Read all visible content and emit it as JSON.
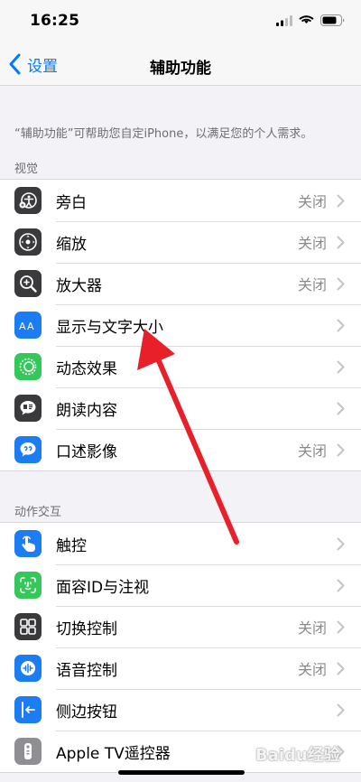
{
  "status_bar": {
    "time": "16:25"
  },
  "nav": {
    "back_label": "设置",
    "title": "辅助功能"
  },
  "description": "“辅助功能”可帮助您自定iPhone，以满足您的个人需求。",
  "sections": [
    {
      "header": "视觉",
      "items": [
        {
          "label": "旁白",
          "value": "关闭",
          "icon": "voiceover-icon",
          "color": "#3a3a3c"
        },
        {
          "label": "缩放",
          "value": "关闭",
          "icon": "zoom-icon",
          "color": "#3a3a3c"
        },
        {
          "label": "放大器",
          "value": "关闭",
          "icon": "magnifier-icon",
          "color": "#3a3a3c"
        },
        {
          "label": "显示与文字大小",
          "value": "",
          "icon": "text-size-icon",
          "color": "#1c7cf4"
        },
        {
          "label": "动态效果",
          "value": "",
          "icon": "motion-icon",
          "color": "#34c759"
        },
        {
          "label": "朗读内容",
          "value": "",
          "icon": "spoken-content-icon",
          "color": "#3a3a3c"
        },
        {
          "label": "口述影像",
          "value": "关闭",
          "icon": "audio-description-icon",
          "color": "#1c7cf4"
        }
      ]
    },
    {
      "header": "动作交互",
      "items": [
        {
          "label": "触控",
          "value": "",
          "icon": "touch-icon",
          "color": "#1c7cf4"
        },
        {
          "label": "面容ID与注视",
          "value": "",
          "icon": "face-id-icon",
          "color": "#34c759"
        },
        {
          "label": "切换控制",
          "value": "关闭",
          "icon": "switch-control-icon",
          "color": "#3a3a3c"
        },
        {
          "label": "语音控制",
          "value": "关闭",
          "icon": "voice-control-icon",
          "color": "#1c7cf4"
        },
        {
          "label": "侧边按钮",
          "value": "",
          "icon": "side-button-icon",
          "color": "#1c7cf4"
        },
        {
          "label": "Apple TV遥控器",
          "value": "",
          "icon": "tv-remote-icon",
          "color": "#8e8e93"
        }
      ]
    }
  ],
  "watermark": "Baidu经验",
  "colors": {
    "accent": "#007aff",
    "annotation_arrow": "#e8202a"
  }
}
